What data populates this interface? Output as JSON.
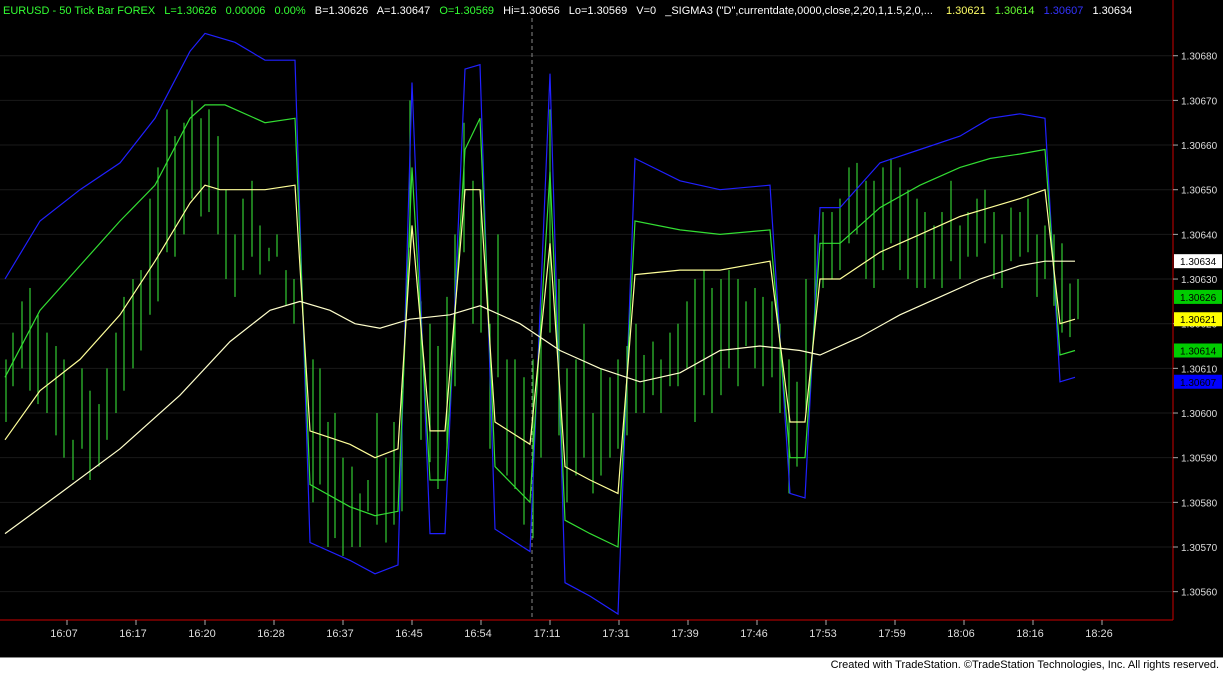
{
  "header": {
    "symbol": "EURUSD - 50 Tick Bar  FOREX",
    "last": "L=1.30626",
    "change": "0.00006",
    "change_pct": "0.00%",
    "bid": "B=1.30626",
    "ask": "A=1.30647",
    "open": "O=1.30569",
    "high": "Hi=1.30656",
    "low": "Lo=1.30569",
    "volume": "V=0",
    "study": "_SIGMA3 (\"D\",currentdate,0000,close,2,20,1,1.5,2,0,...",
    "study_values": [
      {
        "text": "1.30621",
        "color": "#ffff66"
      },
      {
        "text": "1.30614",
        "color": "#66ff33"
      },
      {
        "text": "1.30607",
        "color": "#3333ff"
      },
      {
        "text": "1.30634",
        "color": "#ffffff"
      }
    ]
  },
  "footer": {
    "copyright": "Created with TradeStation. ©TradeStation Technologies, Inc. All rights reserved."
  },
  "chart_data": {
    "type": "line",
    "ylim": [
      1.30555,
      1.30688
    ],
    "y_ticks": [
      "1.30560",
      "1.30570",
      "1.30580",
      "1.30590",
      "1.30600",
      "1.30610",
      "1.30620",
      "1.30630",
      "1.30640",
      "1.30650",
      "1.30660",
      "1.30670",
      "1.30680"
    ],
    "x_ticks": [
      "16:07",
      "16:17",
      "16:20",
      "16:28",
      "16:37",
      "16:45",
      "16:54",
      "17:11",
      "17:31",
      "17:39",
      "17:46",
      "17:53",
      "17:59",
      "18:06",
      "18:16",
      "18:26"
    ],
    "x_tick_positions": [
      67,
      136,
      205,
      274,
      343,
      412,
      481,
      550,
      619,
      688,
      757,
      826,
      895,
      964,
      1033,
      1102
    ],
    "price_labels": [
      {
        "text": "1.30634",
        "value": 1.30634,
        "bg": "#ffffff",
        "fg": "#000000"
      },
      {
        "text": "1.30626",
        "value": 1.30626,
        "bg": "#00cc00",
        "fg": "#000000"
      },
      {
        "text": "1.30621",
        "value": 1.30621,
        "bg": "#ffff00",
        "fg": "#000000"
      },
      {
        "text": "1.30614",
        "value": 1.30614,
        "bg": "#00cc00",
        "fg": "#000000"
      },
      {
        "text": "1.30607",
        "value": 1.30607,
        "bg": "#0000ff",
        "fg": "#000000"
      }
    ],
    "series": [
      {
        "color": "#2020ff",
        "x": [
          5,
          40,
          80,
          120,
          155,
          190,
          205,
          235,
          265,
          295,
          310,
          350,
          375,
          398,
          412,
          430,
          445,
          465,
          480,
          495,
          530,
          550,
          565,
          590,
          618,
          635,
          680,
          720,
          770,
          790,
          805,
          820,
          840,
          880,
          920,
          960,
          990,
          1020,
          1045,
          1060,
          1075
        ],
        "values": [
          1.3063,
          1.30643,
          1.3065,
          1.30656,
          1.30666,
          1.30681,
          1.30685,
          1.30683,
          1.30679,
          1.30679,
          1.30571,
          1.30567,
          1.30564,
          1.30566,
          1.30674,
          1.30573,
          1.30573,
          1.30677,
          1.30678,
          1.30574,
          1.30569,
          1.30676,
          1.30562,
          1.30559,
          1.30555,
          1.30657,
          1.30652,
          1.3065,
          1.30651,
          1.30582,
          1.30581,
          1.30646,
          1.30646,
          1.30656,
          1.30659,
          1.30662,
          1.30666,
          1.30667,
          1.30666,
          1.30607,
          1.30608
        ]
      },
      {
        "color": "#33dd33",
        "x": [
          5,
          40,
          80,
          120,
          155,
          190,
          205,
          225,
          265,
          295,
          310,
          350,
          375,
          398,
          412,
          430,
          445,
          465,
          480,
          495,
          530,
          550,
          565,
          590,
          618,
          635,
          680,
          720,
          770,
          790,
          805,
          820,
          840,
          880,
          920,
          960,
          990,
          1020,
          1045,
          1060,
          1075
        ],
        "values": [
          1.30608,
          1.30623,
          1.30633,
          1.30643,
          1.30651,
          1.30666,
          1.30669,
          1.30669,
          1.30665,
          1.30666,
          1.30584,
          1.30579,
          1.30577,
          1.30578,
          1.30655,
          1.30585,
          1.30585,
          1.30659,
          1.30666,
          1.30588,
          1.3058,
          1.30654,
          1.30576,
          1.30573,
          1.3057,
          1.30643,
          1.30641,
          1.3064,
          1.30641,
          1.3059,
          1.3059,
          1.30638,
          1.30638,
          1.30646,
          1.30651,
          1.30655,
          1.30657,
          1.30658,
          1.30659,
          1.30613,
          1.30614
        ]
      },
      {
        "color": "#ffff99",
        "x": [
          5,
          40,
          80,
          120,
          155,
          190,
          205,
          220,
          265,
          295,
          310,
          350,
          375,
          398,
          412,
          430,
          445,
          465,
          480,
          495,
          530,
          550,
          565,
          590,
          618,
          635,
          680,
          720,
          770,
          790,
          805,
          820,
          840,
          880,
          920,
          960,
          990,
          1020,
          1045,
          1060,
          1075
        ],
        "values": [
          1.30594,
          1.30605,
          1.30612,
          1.30622,
          1.30634,
          1.30647,
          1.30651,
          1.3065,
          1.3065,
          1.30651,
          1.30596,
          1.30593,
          1.3059,
          1.30592,
          1.30642,
          1.30596,
          1.30596,
          1.3065,
          1.3065,
          1.30598,
          1.30593,
          1.30638,
          1.30588,
          1.30585,
          1.30582,
          1.30631,
          1.30632,
          1.30632,
          1.30634,
          1.30598,
          1.30598,
          1.3063,
          1.3063,
          1.30636,
          1.3064,
          1.30644,
          1.30646,
          1.30648,
          1.3065,
          1.3062,
          1.30621
        ]
      },
      {
        "color": "#ffffcc",
        "x": [
          5,
          60,
          120,
          180,
          230,
          270,
          300,
          330,
          355,
          380,
          410,
          450,
          480,
          520,
          560,
          600,
          640,
          680,
          720,
          760,
          800,
          820,
          860,
          900,
          940,
          980,
          1020,
          1045,
          1075
        ],
        "values": [
          1.30573,
          1.30582,
          1.30592,
          1.30604,
          1.30616,
          1.30623,
          1.30625,
          1.30623,
          1.3062,
          1.30619,
          1.30621,
          1.30622,
          1.30624,
          1.3062,
          1.30614,
          1.3061,
          1.30607,
          1.30609,
          1.30614,
          1.30615,
          1.30614,
          1.30613,
          1.30617,
          1.30622,
          1.30626,
          1.3063,
          1.30633,
          1.30634,
          1.30634
        ]
      }
    ],
    "bars": {
      "color": "#33cc33",
      "x": [
        6,
        13,
        22,
        30,
        38,
        47,
        56,
        64,
        73,
        82,
        90,
        99,
        107,
        116,
        124,
        133,
        141,
        150,
        158,
        167,
        175,
        184,
        192,
        201,
        209,
        218,
        226,
        235,
        243,
        252,
        260,
        269,
        277,
        286,
        294,
        313,
        320,
        328,
        335,
        343,
        352,
        360,
        368,
        377,
        386,
        394,
        402,
        410,
        421,
        430,
        438,
        447,
        455,
        464,
        473,
        481,
        490,
        498,
        507,
        515,
        524,
        533,
        541,
        550,
        559,
        567,
        576,
        584,
        593,
        601,
        610,
        618,
        627,
        636,
        644,
        653,
        661,
        670,
        678,
        687,
        695,
        704,
        712,
        721,
        729,
        738,
        746,
        755,
        763,
        772,
        780,
        789,
        797,
        806,
        815,
        823,
        832,
        840,
        849,
        857,
        866,
        874,
        883,
        891,
        900,
        908,
        917,
        925,
        934,
        942,
        951,
        960,
        968,
        977,
        985,
        994,
        1002,
        1011,
        1020,
        1028,
        1037,
        1045,
        1054,
        1062,
        1070,
        1078
      ],
      "highs": [
        1.30612,
        1.30618,
        1.30625,
        1.30628,
        1.30622,
        1.30618,
        1.30615,
        1.30612,
        1.30594,
        1.3061,
        1.30605,
        1.30602,
        1.3061,
        1.30618,
        1.30626,
        1.3063,
        1.30632,
        1.30648,
        1.30655,
        1.30668,
        1.30662,
        1.30665,
        1.3067,
        1.30666,
        1.30668,
        1.30662,
        1.3065,
        1.3064,
        1.30648,
        1.30652,
        1.30642,
        1.30637,
        1.3064,
        1.30632,
        1.3063,
        1.30612,
        1.3061,
        1.30598,
        1.306,
        1.3059,
        1.30588,
        1.30582,
        1.30585,
        1.306,
        1.3059,
        1.30598,
        1.30605,
        1.3067,
        1.30625,
        1.3062,
        1.30615,
        1.30626,
        1.3064,
        1.30665,
        1.30652,
        1.3065,
        1.3062,
        1.3064,
        1.30612,
        1.30612,
        1.30608,
        1.30612,
        1.3062,
        1.30668,
        1.3063,
        1.3061,
        1.30612,
        1.3062,
        1.306,
        1.3061,
        1.30608,
        1.30612,
        1.30615,
        1.3062,
        1.30613,
        1.30616,
        1.30612,
        1.30618,
        1.3062,
        1.30625,
        1.3063,
        1.30632,
        1.30628,
        1.3063,
        1.30632,
        1.3063,
        1.30625,
        1.30628,
        1.30626,
        1.30625,
        1.3062,
        1.30612,
        1.30607,
        1.3063,
        1.3064,
        1.30645,
        1.30645,
        1.30648,
        1.30655,
        1.30656,
        1.30652,
        1.30652,
        1.30655,
        1.30657,
        1.30655,
        1.3065,
        1.30648,
        1.30645,
        1.30642,
        1.30645,
        1.30652,
        1.30642,
        1.30645,
        1.30648,
        1.3065,
        1.30645,
        1.3064,
        1.30646,
        1.30645,
        1.30648,
        1.3064,
        1.30642,
        1.3064,
        1.30638,
        1.30629,
        1.3063
      ],
      "lows": [
        1.30598,
        1.30606,
        1.3061,
        1.30605,
        1.30602,
        1.306,
        1.30595,
        1.3059,
        1.30585,
        1.30592,
        1.30585,
        1.30588,
        1.30594,
        1.306,
        1.30605,
        1.3061,
        1.30614,
        1.30622,
        1.30625,
        1.30636,
        1.30635,
        1.3064,
        1.30648,
        1.30644,
        1.30645,
        1.3064,
        1.3063,
        1.30626,
        1.30632,
        1.30635,
        1.30631,
        1.30634,
        1.30635,
        1.30624,
        1.3062,
        1.3058,
        1.30584,
        1.3057,
        1.30572,
        1.30568,
        1.3057,
        1.3057,
        1.30578,
        1.30575,
        1.30571,
        1.30575,
        1.30578,
        1.30637,
        1.30594,
        1.30589,
        1.30583,
        1.30592,
        1.30606,
        1.30636,
        1.3062,
        1.30618,
        1.30592,
        1.30608,
        1.30586,
        1.30583,
        1.30575,
        1.30572,
        1.3059,
        1.30618,
        1.30595,
        1.3058,
        1.30586,
        1.3059,
        1.30582,
        1.30586,
        1.3059,
        1.30592,
        1.30595,
        1.306,
        1.306,
        1.30604,
        1.306,
        1.30606,
        1.30606,
        1.3061,
        1.30598,
        1.30604,
        1.306,
        1.30604,
        1.3061,
        1.30606,
        1.30615,
        1.3061,
        1.30606,
        1.30608,
        1.306,
        1.30582,
        1.30588,
        1.306,
        1.3062,
        1.30628,
        1.3063,
        1.30632,
        1.30638,
        1.3064,
        1.3063,
        1.30628,
        1.30632,
        1.30638,
        1.30632,
        1.3063,
        1.30628,
        1.30628,
        1.3063,
        1.30628,
        1.30634,
        1.3063,
        1.30635,
        1.30635,
        1.30638,
        1.3063,
        1.30628,
        1.30634,
        1.30635,
        1.30636,
        1.30626,
        1.3063,
        1.30624,
        1.30618,
        1.30617,
        1.30621
      ]
    }
  }
}
